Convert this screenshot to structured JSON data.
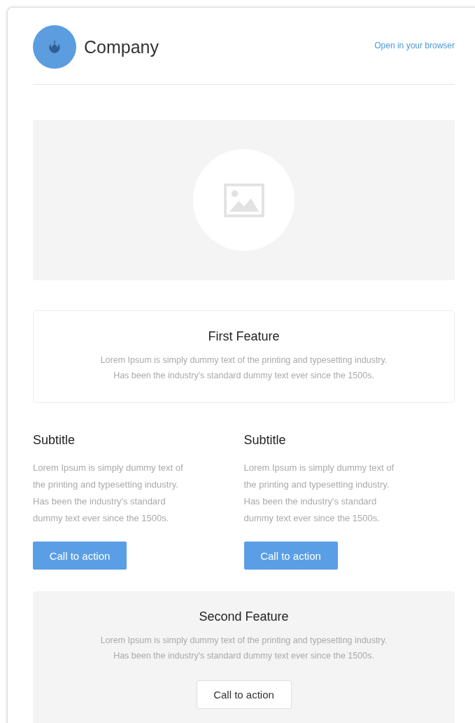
{
  "header": {
    "company": "Company",
    "link": "Open in your browser"
  },
  "first_feature": {
    "title": "First Feature",
    "lines": [
      "Lorem Ipsum is simply dummy text of the printing and typesetting industry.",
      "Has been the industry's standard dummy text ever since the 1500s."
    ]
  },
  "columns": [
    {
      "subtitle": "Subtitle",
      "lines": [
        "Lorem Ipsum is simply dummy text of",
        "the printing and typesetting industry.",
        "Has been the industry's standard",
        "dummy text ever since the 1500s."
      ],
      "button": "Call to action"
    },
    {
      "subtitle": "Subtitle",
      "lines": [
        "Lorem Ipsum is simply dummy text of",
        "the printing and typesetting industry.",
        "Has been the industry's standard",
        "dummy text ever since the 1500s."
      ],
      "button": "Call to action"
    }
  ],
  "second_feature": {
    "title": "Second Feature",
    "lines": [
      "Lorem Ipsum is simply dummy text of the printing and typesetting industry.",
      "Has been the industry's standard dummy text ever since the 1500s."
    ],
    "button": "Call to action"
  }
}
